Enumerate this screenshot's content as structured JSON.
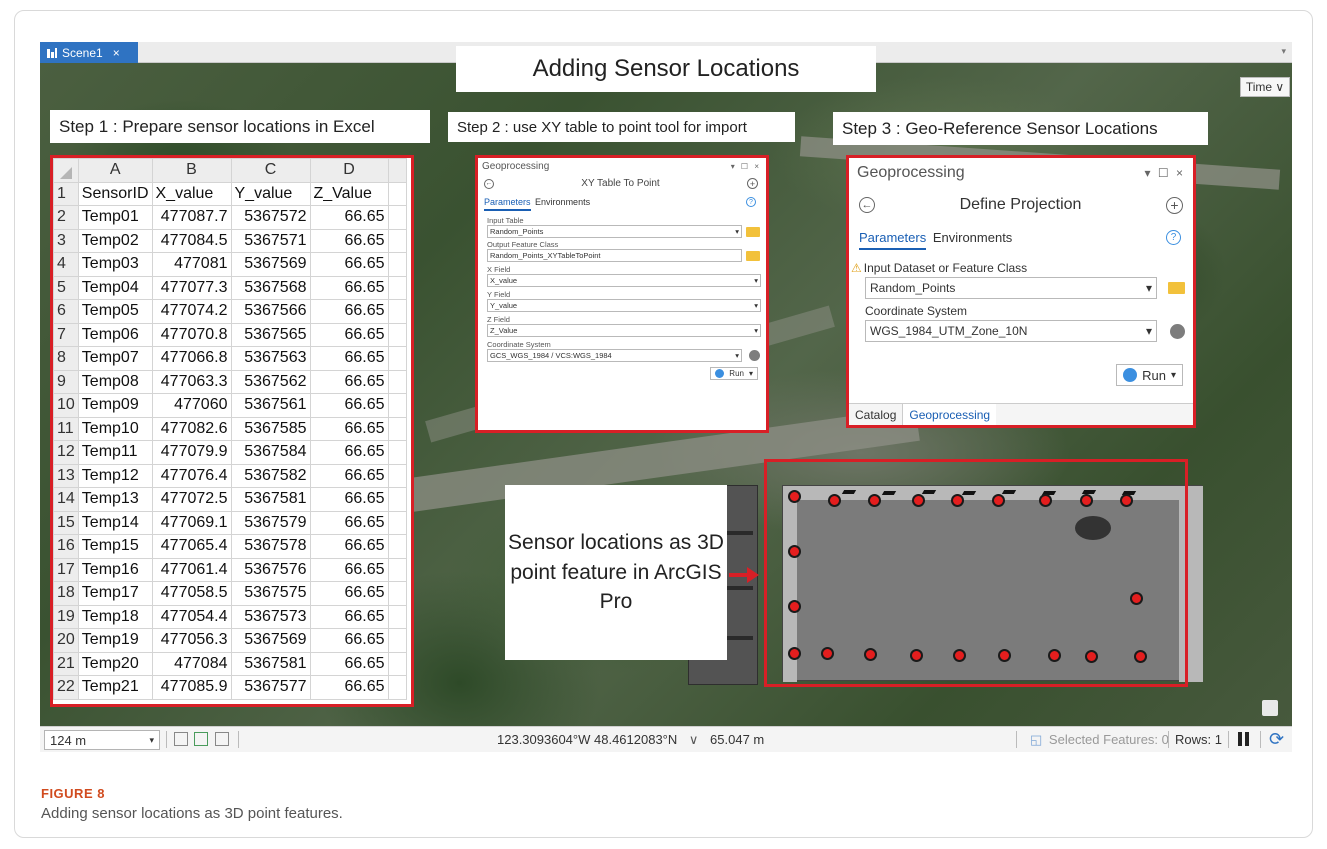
{
  "tab": {
    "label": "Scene1",
    "close": "×"
  },
  "title": "Adding Sensor Locations",
  "time_button": "Time ∨",
  "steps": {
    "step1": "Step 1 : Prepare sensor locations in Excel",
    "step2": "Step 2 : use XY table to point tool for import",
    "step3": "Step 3 : Geo-Reference  Sensor Locations"
  },
  "excel": {
    "col_letters": [
      "A",
      "B",
      "C",
      "D"
    ],
    "rows": [
      [
        "1",
        "SensorID",
        "X_value",
        "Y_value",
        "Z_Value"
      ],
      [
        "2",
        "Temp01",
        "477087.7",
        "5367572",
        "66.65"
      ],
      [
        "3",
        "Temp02",
        "477084.5",
        "5367571",
        "66.65"
      ],
      [
        "4",
        "Temp03",
        "477081",
        "5367569",
        "66.65"
      ],
      [
        "5",
        "Temp04",
        "477077.3",
        "5367568",
        "66.65"
      ],
      [
        "6",
        "Temp05",
        "477074.2",
        "5367566",
        "66.65"
      ],
      [
        "7",
        "Temp06",
        "477070.8",
        "5367565",
        "66.65"
      ],
      [
        "8",
        "Temp07",
        "477066.8",
        "5367563",
        "66.65"
      ],
      [
        "9",
        "Temp08",
        "477063.3",
        "5367562",
        "66.65"
      ],
      [
        "10",
        "Temp09",
        "477060",
        "5367561",
        "66.65"
      ],
      [
        "11",
        "Temp10",
        "477082.6",
        "5367585",
        "66.65"
      ],
      [
        "12",
        "Temp11",
        "477079.9",
        "5367584",
        "66.65"
      ],
      [
        "13",
        "Temp12",
        "477076.4",
        "5367582",
        "66.65"
      ],
      [
        "14",
        "Temp13",
        "477072.5",
        "5367581",
        "66.65"
      ],
      [
        "15",
        "Temp14",
        "477069.1",
        "5367579",
        "66.65"
      ],
      [
        "16",
        "Temp15",
        "477065.4",
        "5367578",
        "66.65"
      ],
      [
        "17",
        "Temp16",
        "477061.4",
        "5367576",
        "66.65"
      ],
      [
        "18",
        "Temp17",
        "477058.5",
        "5367575",
        "66.65"
      ],
      [
        "19",
        "Temp18",
        "477054.4",
        "5367573",
        "66.65"
      ],
      [
        "20",
        "Temp19",
        "477056.3",
        "5367569",
        "66.65"
      ],
      [
        "21",
        "Temp20",
        "477084",
        "5367581",
        "66.65"
      ],
      [
        "22",
        "Temp21",
        "477085.9",
        "5367577",
        "66.65"
      ]
    ]
  },
  "gp_xy": {
    "panel_title": "Geoprocessing",
    "window_controls": "▾ ☐ ×",
    "tool_title": "XY Table To Point",
    "tab_parameters": "Parameters",
    "tab_environments": "Environments",
    "fields": [
      {
        "label": "Input Table",
        "value": "Random_Points",
        "kind": "dropdown-folder"
      },
      {
        "label": "Output Feature Class",
        "value": "Random_Points_XYTableToPoint",
        "kind": "folder"
      },
      {
        "label": "X Field",
        "value": "X_value",
        "kind": "dropdown"
      },
      {
        "label": "Y Field",
        "value": "Y_value",
        "kind": "dropdown"
      },
      {
        "label": "Z Field",
        "value": "Z_Value",
        "kind": "dropdown"
      },
      {
        "label": "Coordinate System",
        "value": "GCS_WGS_1984 / VCS:WGS_1984",
        "kind": "dropdown-globe"
      }
    ],
    "run": "Run"
  },
  "gp_def": {
    "panel_title": "Geoprocessing",
    "window_controls": "▾ ☐ ×",
    "tool_title": "Define Projection",
    "tab_parameters": "Parameters",
    "tab_environments": "Environments",
    "field1_label": "Input Dataset or Feature Class",
    "field1_value": "Random_Points",
    "field2_label": "Coordinate System",
    "field2_value": "WGS_1984_UTM_Zone_10N",
    "run": "Run",
    "bottom_tab_catalog": "Catalog",
    "bottom_tab_geoprocessing": "Geoprocessing"
  },
  "callout": "Sensor locations as 3D point feature in ArcGIS Pro",
  "statusbar": {
    "scale": "124 m",
    "coordinates": "123.3093604°W 48.4612083°N",
    "coord_dropdown": "∨",
    "elevation": "65.047 m",
    "selected_features": "Selected Features: 0",
    "rows": "Rows: 1"
  },
  "caption": {
    "figure_label": "FIGURE 8",
    "text": "Adding sensor locations as 3D point features."
  },
  "colors": {
    "highlight_red": "#d81f26",
    "tab_blue": "#2f73c2",
    "sensor_red": "#e41e1e"
  }
}
